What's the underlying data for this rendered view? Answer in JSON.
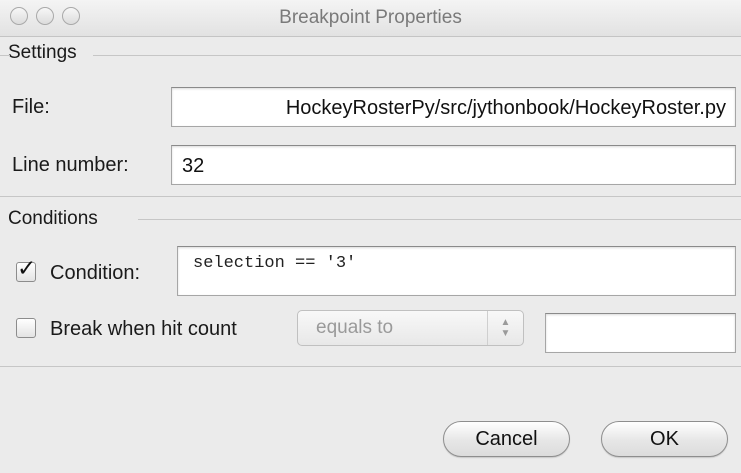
{
  "window": {
    "title": "Breakpoint Properties"
  },
  "settings": {
    "section_label": "Settings",
    "file_label": "File:",
    "file_value": "HockeyRosterPy/src/jythonbook/HockeyRoster.py",
    "line_label": "Line number:",
    "line_value": "32"
  },
  "conditions": {
    "section_label": "Conditions",
    "condition_checked": true,
    "condition_label": "Condition:",
    "condition_value": "selection == '3'",
    "hit_count_checked": false,
    "hit_count_label": "Break when hit count",
    "hit_count_mode": "equals to",
    "hit_count_value": ""
  },
  "buttons": {
    "cancel": "Cancel",
    "ok": "OK"
  },
  "icons": {
    "checkmark": "✓",
    "updown": "▲▼"
  }
}
